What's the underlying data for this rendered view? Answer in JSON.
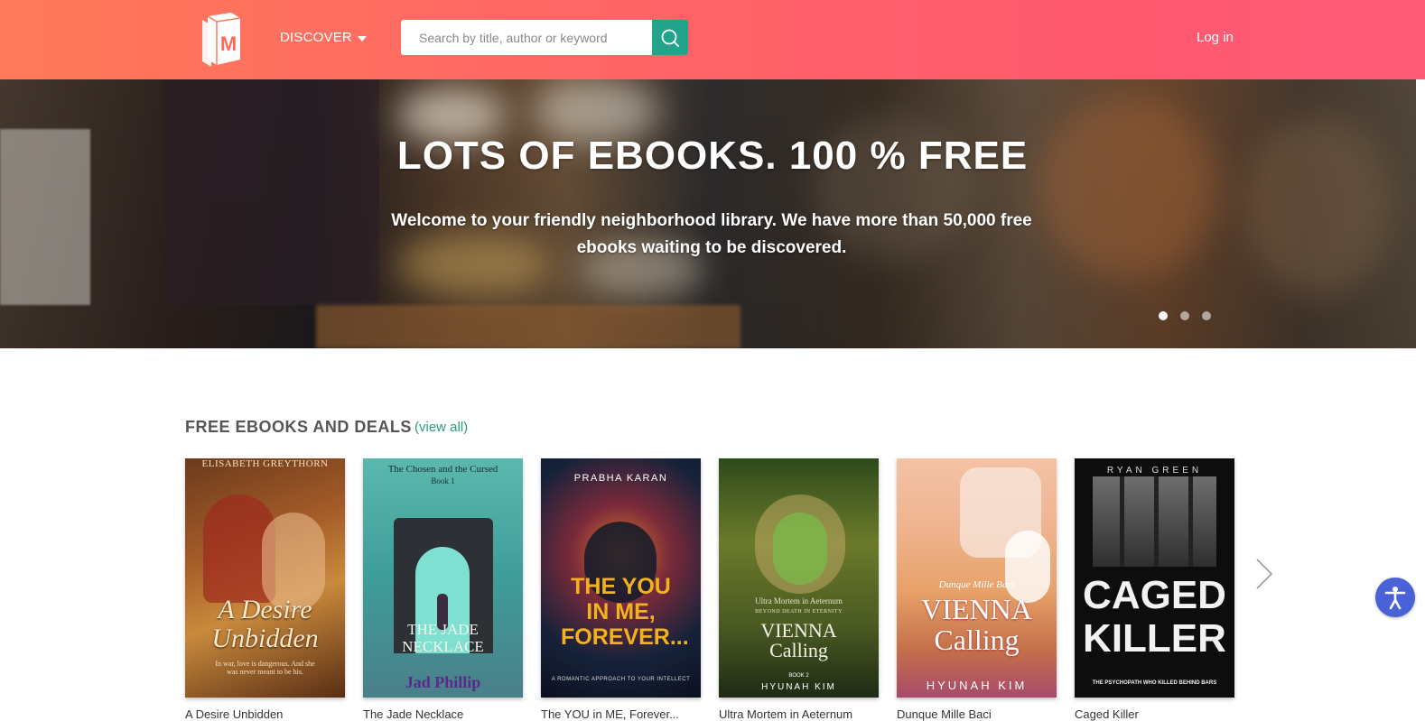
{
  "header": {
    "discover_label": "DISCOVER",
    "search_placeholder": "Search by title, author or keyword",
    "login_label": "Log in",
    "logo_letter": "M"
  },
  "hero": {
    "title": "LOTS OF EBOOKS. 100 % FREE",
    "subtitle": "Welcome to your friendly neighborhood library. We have more than 50,000 free ebooks waiting to be discovered.",
    "slides": 3,
    "active_slide": 1
  },
  "section": {
    "title": "FREE EBOOKS AND DEALS",
    "view_all": "(view all)"
  },
  "books": [
    {
      "cover_top": "ELISABETH GREYTHORN",
      "cover_title": "A Desire Unbidden",
      "cover_sub": "In war, love is dangerous. And she was never meant to be his.",
      "caption": "A Desire Unbidden"
    },
    {
      "cover_top": "The Chosen and the Cursed",
      "cover_series": "Book 1",
      "cover_title": "THE JADE NECKLACE",
      "cover_author": "Jad Phillip",
      "caption": "The Jade Necklace"
    },
    {
      "cover_top": "PRABHA KARAN",
      "cover_title": "THE YOU IN ME, FOREVER...",
      "cover_sub": "A ROMANTIC APPROACH TO YOUR INTELLECT",
      "caption": "The YOU in ME, Forever..."
    },
    {
      "cover_top": "Ultra Mortem in Aeternum",
      "cover_series": "BEYOND DEATH IN ETERNITY",
      "cover_title": "VIENNA Calling",
      "cover_book": "BOOK 2",
      "cover_author": "HYUNAH KIM",
      "caption": "Ultra Mortem in Aeternum"
    },
    {
      "cover_top": "Dunque Mille Baci",
      "cover_title": "VIENNA Calling",
      "cover_author": "HYUNAH KIM",
      "caption": "Dunque Mille Baci"
    },
    {
      "cover_top": "RYAN GREEN",
      "cover_title": "CAGED KILLER",
      "cover_sub": "THE PSYCHOPATH WHO KILLED BEHIND BARS",
      "caption": "Caged Killer"
    }
  ],
  "colors": {
    "header_gradient_start": "#ff7a59",
    "header_gradient_end": "#ff5b78",
    "search_button": "#22a38a",
    "link": "#2a9c82",
    "accessibility_button": "#4a62d8"
  },
  "icons": {
    "search": "search-icon",
    "logo": "book-logo-icon",
    "next": "chevron-right-icon",
    "accessibility": "accessibility-icon"
  }
}
